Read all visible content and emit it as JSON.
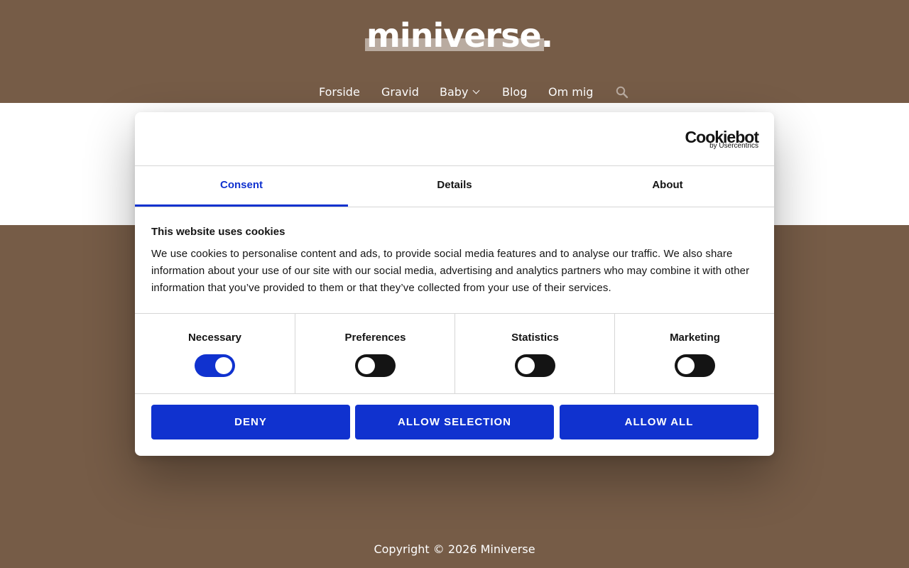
{
  "site": {
    "logo_text": "miniverse.",
    "nav": [
      {
        "label": "Forside"
      },
      {
        "label": "Gravid"
      },
      {
        "label": "Baby"
      },
      {
        "label": "Blog"
      },
      {
        "label": "Om mig"
      }
    ],
    "footer": "Copyright © 2026 Miniverse"
  },
  "cookie": {
    "brand_main": "Cookiebot",
    "brand_sub": "by Usercentrics",
    "tabs": [
      {
        "label": "Consent",
        "active": true
      },
      {
        "label": "Details",
        "active": false
      },
      {
        "label": "About",
        "active": false
      }
    ],
    "title": "This website uses cookies",
    "body": "We use cookies to personalise content and ads, to provide social media features and to analyse our traffic. We also share information about your use of our site with our social media, advertising and analytics partners who may combine it with other information that you’ve provided to them or that they’ve collected from your use of their services.",
    "categories": [
      {
        "label": "Necessary",
        "enabled": true
      },
      {
        "label": "Preferences",
        "enabled": false
      },
      {
        "label": "Statistics",
        "enabled": false
      },
      {
        "label": "Marketing",
        "enabled": false
      }
    ],
    "buttons": {
      "deny": "DENY",
      "allow_selection": "ALLOW SELECTION",
      "allow_all": "ALLOW ALL"
    }
  },
  "colors": {
    "brand_brown": "#765c47",
    "cookiebot_blue": "#1032cf"
  }
}
